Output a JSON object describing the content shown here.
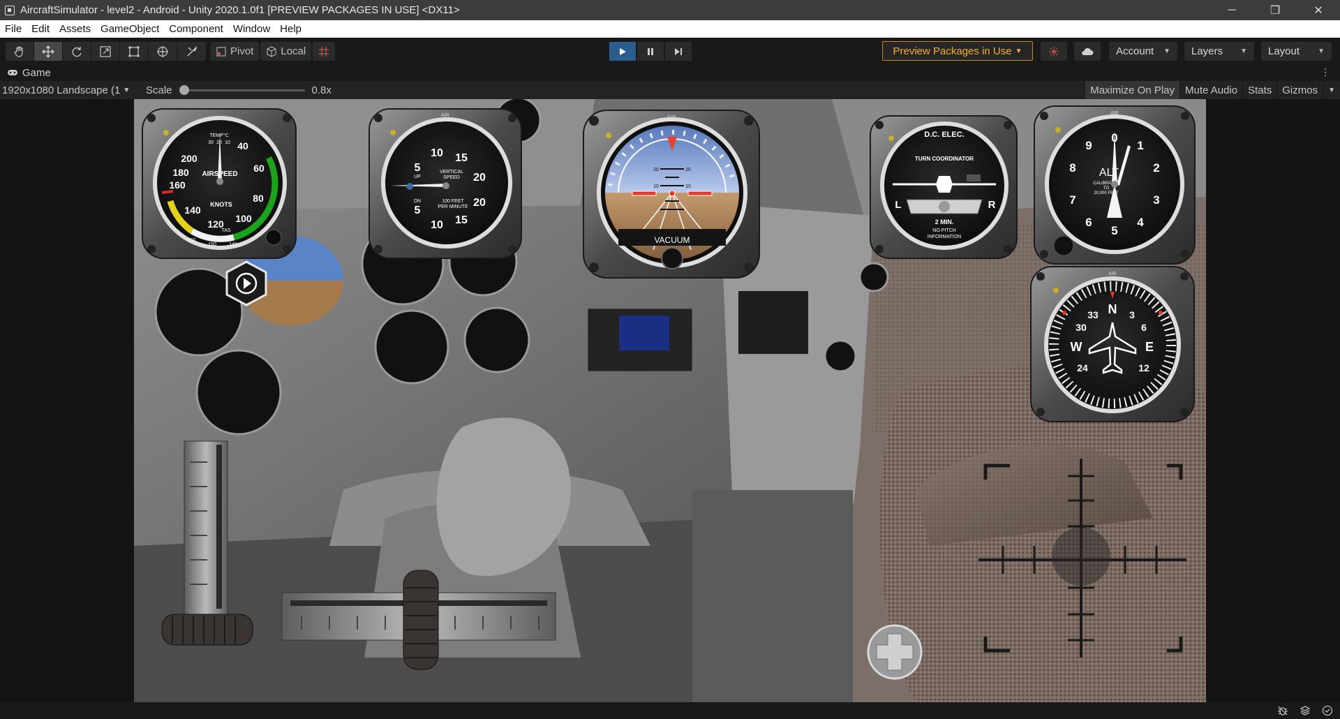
{
  "window": {
    "title": "AircraftSimulator - level2 - Android - Unity 2020.1.0f1 [PREVIEW PACKAGES IN USE] <DX11>",
    "minimize": "─",
    "restore": "❐",
    "close": "✕"
  },
  "menu": [
    "File",
    "Edit",
    "Assets",
    "GameObject",
    "Component",
    "Window",
    "Help"
  ],
  "toolbar": {
    "pivot_label": "Pivot",
    "local_label": "Local",
    "preview_label": "Preview Packages in Use",
    "account_label": "Account",
    "layers_label": "Layers",
    "layout_label": "Layout"
  },
  "game_tab": {
    "label": "Game"
  },
  "game_view": {
    "resolution": "1920x1080 Landscape (1",
    "scale_label": "Scale",
    "scale_value": "0.8x",
    "scale_fraction": 0.0,
    "maximize_label": "Maximize On Play",
    "mute_label": "Mute Audio",
    "stats_label": "Stats",
    "gizmos_label": "Gizmos"
  },
  "instruments": {
    "airspeed": {
      "top": "TEMP°C",
      "top_nums": [
        "30",
        "20",
        "10"
      ],
      "label": "AIRSPEED",
      "unit": "KNOTS",
      "tas": "TAS",
      "ticks": [
        "40",
        "60",
        "80",
        "100",
        "120",
        "140",
        "160",
        "180",
        "200"
      ],
      "inner": [
        "160",
        "150",
        "140"
      ]
    },
    "vsi": {
      "air": "AIR",
      "nums": [
        "5",
        "10",
        "15",
        "20",
        "20",
        "15",
        "10",
        "5"
      ],
      "up": "UP",
      "dn": "DN",
      "title1": "VERTICAL",
      "title2": "SPEED",
      "sub1": "100 FEET",
      "sub2": "PER MINUTE"
    },
    "attitude": {
      "air": "AIR",
      "label": "VACUUM",
      "pitch": [
        "20",
        "10",
        "10",
        "20"
      ]
    },
    "turn_coordinator": {
      "brand": "D.C. ELEC.",
      "title": "TURN COORDINATOR",
      "left": "L",
      "right": "R",
      "min": "2 MIN.",
      "note1": "NO PITCH",
      "note2": "INFORMATION"
    },
    "altimeter": {
      "air": "AIR",
      "label": "ALT",
      "nums": [
        "0",
        "1",
        "2",
        "3",
        "4",
        "5",
        "6",
        "7",
        "8",
        "9"
      ],
      "cal1": "CALIBRATED",
      "cal2": "TO",
      "cal3": "20,000 FEET"
    },
    "heading": {
      "air": "AIR",
      "cards": [
        "N",
        "3",
        "6",
        "E",
        "12",
        "24",
        "W",
        "30",
        "33"
      ]
    }
  },
  "colors": {
    "accent": "#2c5d8f",
    "preview": "#f2b12a",
    "attitude_sky": "#6e8fc7",
    "attitude_ground": "#a87d55",
    "ias_green": "#1ba31b",
    "ias_yellow": "#e6d11a",
    "ias_white": "#f2f2f2"
  },
  "icons": {
    "hand": "hand-tool-icon",
    "move": "move-tool-icon",
    "rotate": "rotate-tool-icon",
    "scale": "scale-tool-icon",
    "rect": "rect-tool-icon",
    "transform": "transform-tool-icon",
    "custom": "custom-tool-icon",
    "grid": "grid-snap-icon",
    "play": "play-icon",
    "pause": "pause-icon",
    "step": "step-icon",
    "collab": "collab-icon",
    "cloud": "cloud-icon"
  }
}
